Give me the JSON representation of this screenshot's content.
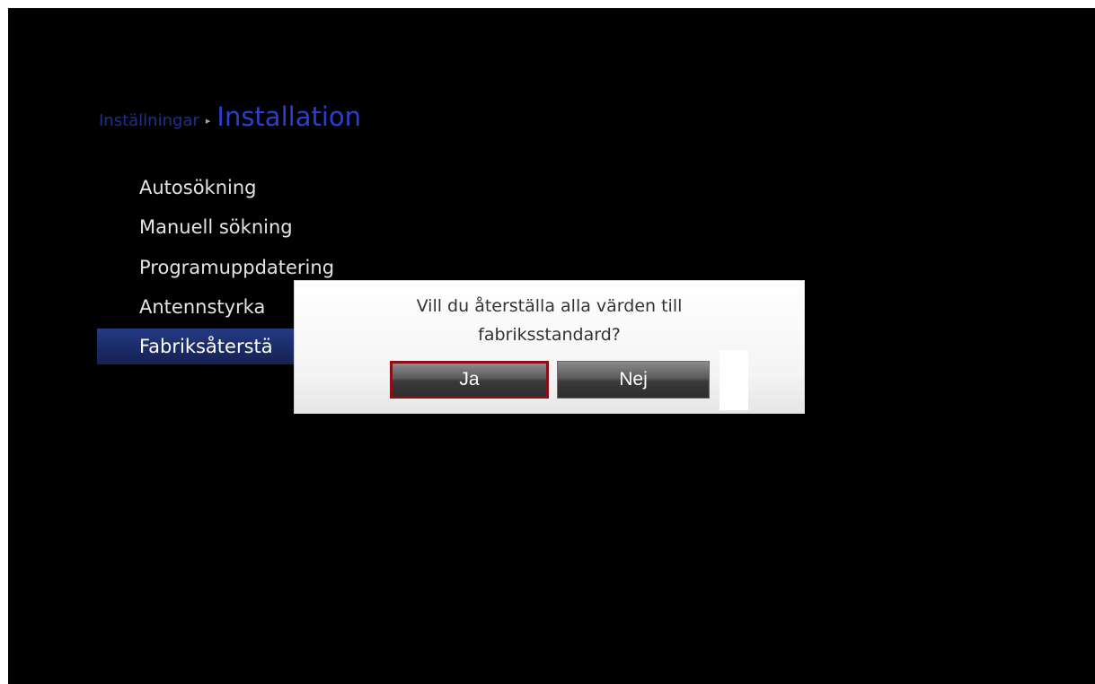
{
  "breadcrumb": {
    "parent": "Inställningar",
    "separator": "▸",
    "current": "Installation"
  },
  "menu": {
    "items": [
      {
        "label": "Autosökning"
      },
      {
        "label": "Manuell sökning"
      },
      {
        "label": "Programuppdatering"
      },
      {
        "label": "Antennstyrka"
      },
      {
        "label": "Fabriksåterställning",
        "visible_label": "Fabriksåterstä",
        "selected": true
      }
    ]
  },
  "dialog": {
    "message_line1": "Vill du återställa alla värden till",
    "message_line2": "fabriksstandard?",
    "yes_label": "Ja",
    "no_label": "Nej",
    "focused": "Ja"
  },
  "colors": {
    "background": "#000000",
    "breadcrumb_current": "#2a3fd0",
    "selected_row": "#1a2a66",
    "focus_border": "#8a0f17"
  }
}
